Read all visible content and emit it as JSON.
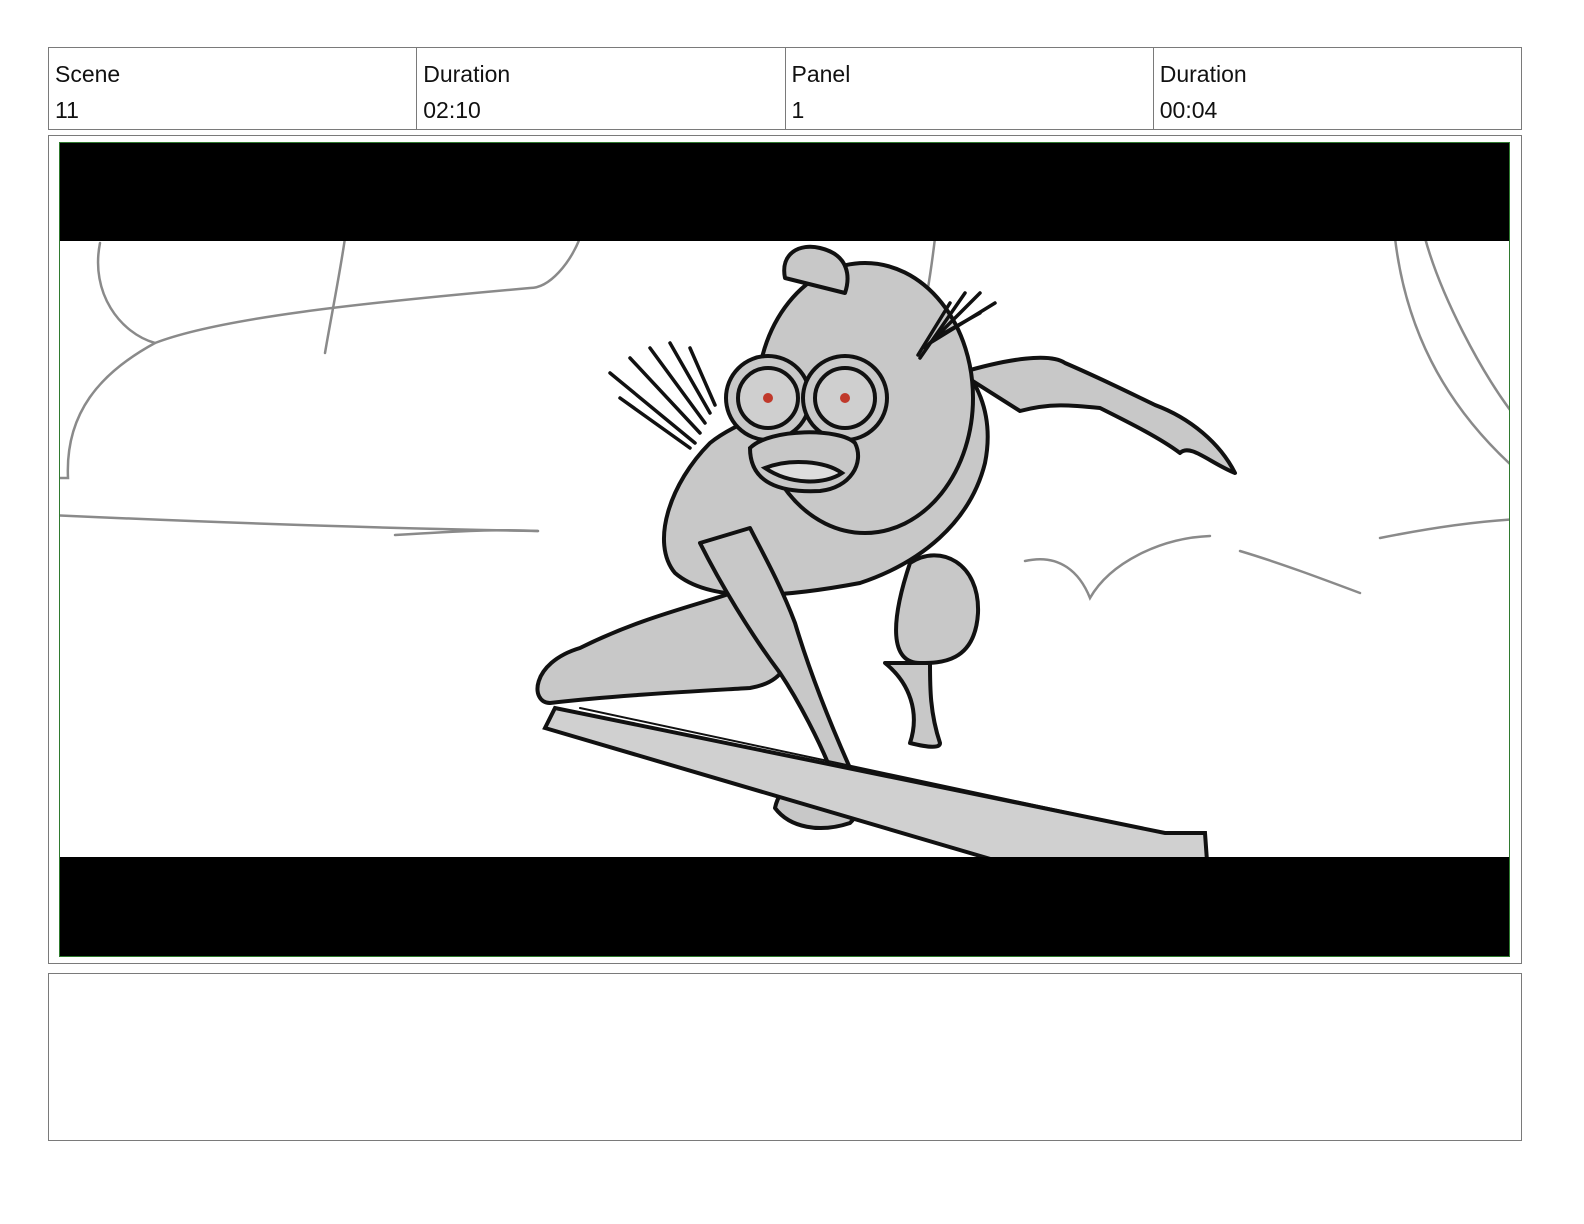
{
  "header": {
    "scene_label": "Scene",
    "scene_value": "11",
    "scene_duration_label": "Duration",
    "scene_duration_value": "02:10",
    "panel_label": "Panel",
    "panel_value": "1",
    "panel_duration_label": "Duration",
    "panel_duration_value": "00:04"
  },
  "panel_image": {
    "letterbox_color": "#000000",
    "frame_color": "#2f7a2f",
    "character_fill": "#c8c8c8",
    "eye_color": "#c0392b"
  },
  "notes": {
    "text": ""
  }
}
